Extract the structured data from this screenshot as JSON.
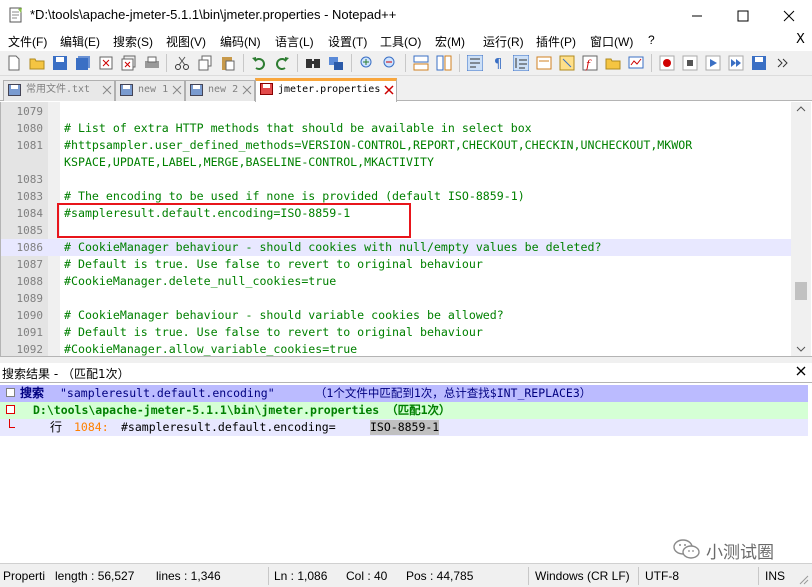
{
  "window": {
    "title": "*D:\\tools\\apache-jmeter-5.1.1\\bin\\jmeter.properties - Notepad++"
  },
  "menu": [
    "文件(F)",
    "编辑(E)",
    "搜索(S)",
    "视图(V)",
    "编码(N)",
    "语言(L)",
    "设置(T)",
    "工具(O)",
    "宏(M)",
    "运行(R)",
    "插件(P)",
    "窗口(W)",
    "?"
  ],
  "menu_close": "X",
  "tabs": [
    {
      "label": "常用文件.txt",
      "active": false
    },
    {
      "label": "new 1",
      "active": false
    },
    {
      "label": "new 2",
      "active": false
    },
    {
      "label": "jmeter.properties",
      "active": true
    }
  ],
  "editor": {
    "lines": [
      {
        "no": "1079",
        "text": ""
      },
      {
        "no": "1080",
        "text": "# List of extra HTTP methods that should be available in select box"
      },
      {
        "no": "1081",
        "text": "#httpsampler.user_defined_methods=VERSION-CONTROL,REPORT,CHECKOUT,CHECKIN,UNCHECKOUT,MKWOR"
      },
      {
        "no": "",
        "text": "KSPACE,UPDATE,LABEL,MERGE,BASELINE-CONTROL,MKACTIVITY"
      },
      {
        "no": "1083",
        "text": ""
      },
      {
        "no": "1083",
        "text": "# The encoding to be used if none is provided (default ISO-8859-1)"
      },
      {
        "no": "1084",
        "text": "#sampleresult.default.encoding=ISO-8859-1"
      },
      {
        "no": "1085",
        "text": ""
      },
      {
        "no": "1086",
        "text": "# CookieManager behaviour - should cookies with null/empty values be deleted?"
      },
      {
        "no": "1087",
        "text": "# Default is true. Use false to revert to original behaviour"
      },
      {
        "no": "1088",
        "text": "#CookieManager.delete_null_cookies=true"
      },
      {
        "no": "1089",
        "text": ""
      },
      {
        "no": "1090",
        "text": "# CookieManager behaviour - should variable cookies be allowed?"
      },
      {
        "no": "1091",
        "text": "# Default is true. Use false to revert to original behaviour"
      },
      {
        "no": "1092",
        "text": "#CookieManager.allow_variable_cookies=true"
      }
    ]
  },
  "search_results": {
    "title": "搜索结果 - （匹配1次）",
    "summary_prefix": "搜索 ",
    "summary_query": "\"sampleresult.default.encoding\"",
    "summary_suffix": " （1个文件中匹配到1次，总计查找$INT_REPLACE3）",
    "file_line": "D:\\tools\\apache-jmeter-5.1.1\\bin\\jmeter.properties （匹配1次）",
    "hit_label": "行",
    "hit_lineno": "1084:",
    "hit_text_before": "#sampleresult.default.encoding=",
    "hit_match": "ISO-8859-1"
  },
  "watermark": "小测试圈",
  "status": {
    "type": "Properti",
    "length": "length : 56,527",
    "lines": "lines : 1,346",
    "ln": "Ln : 1,086",
    "col": "Col : 40",
    "pos": "Pos : 44,785",
    "eol": "Windows (CR LF)",
    "encoding": "UTF-8",
    "mode": "INS"
  }
}
